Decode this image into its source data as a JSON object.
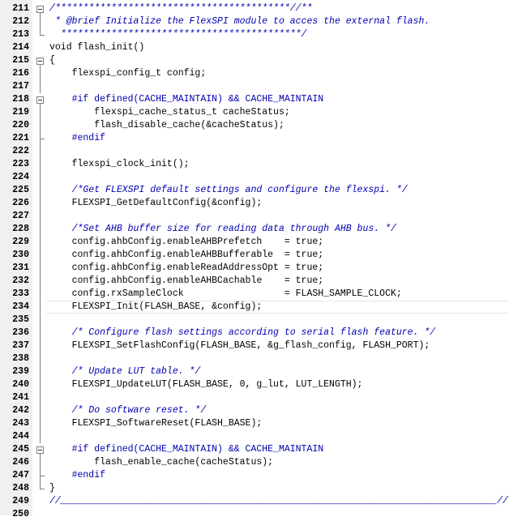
{
  "editor": {
    "lines": [
      {
        "num": "211",
        "text": "/******************************************//**"
      },
      {
        "num": "212",
        "text": " * @brief Initialize the FlexSPI module to acces the external flash."
      },
      {
        "num": "213",
        "text": "  *******************************************/"
      },
      {
        "num": "214",
        "text": "void flash_init()"
      },
      {
        "num": "215",
        "text": "{"
      },
      {
        "num": "216",
        "text": "    flexspi_config_t config;"
      },
      {
        "num": "217",
        "text": ""
      },
      {
        "num": "218",
        "text": "    #if defined(CACHE_MAINTAIN) && CACHE_MAINTAIN"
      },
      {
        "num": "219",
        "text": "        flexspi_cache_status_t cacheStatus;"
      },
      {
        "num": "220",
        "text": "        flash_disable_cache(&cacheStatus);"
      },
      {
        "num": "221",
        "text": "    #endif"
      },
      {
        "num": "222",
        "text": ""
      },
      {
        "num": "223",
        "text": "    flexspi_clock_init();"
      },
      {
        "num": "224",
        "text": ""
      },
      {
        "num": "225",
        "text": "    /*Get FLEXSPI default settings and configure the flexspi. */"
      },
      {
        "num": "226",
        "text": "    FLEXSPI_GetDefaultConfig(&config);"
      },
      {
        "num": "227",
        "text": ""
      },
      {
        "num": "228",
        "text": "    /*Set AHB buffer size for reading data through AHB bus. */"
      },
      {
        "num": "229",
        "text": "    config.ahbConfig.enableAHBPrefetch    = true;"
      },
      {
        "num": "230",
        "text": "    config.ahbConfig.enableAHBBufferable  = true;"
      },
      {
        "num": "231",
        "text": "    config.ahbConfig.enableReadAddressOpt = true;"
      },
      {
        "num": "232",
        "text": "    config.ahbConfig.enableAHBCachable    = true;"
      },
      {
        "num": "233",
        "text": "    config.rxSampleClock                  = FLASH_SAMPLE_CLOCK;"
      },
      {
        "num": "234",
        "text": "    FLEXSPI_Init(FLASH_BASE, &config);"
      },
      {
        "num": "235",
        "text": ""
      },
      {
        "num": "236",
        "text": "    /* Configure flash settings according to serial flash feature. */"
      },
      {
        "num": "237",
        "text": "    FLEXSPI_SetFlashConfig(FLASH_BASE, &g_flash_config, FLASH_PORT);"
      },
      {
        "num": "238",
        "text": ""
      },
      {
        "num": "239",
        "text": "    /* Update LUT table. */"
      },
      {
        "num": "240",
        "text": "    FLEXSPI_UpdateLUT(FLASH_BASE, 0, g_lut, LUT_LENGTH);"
      },
      {
        "num": "241",
        "text": ""
      },
      {
        "num": "242",
        "text": "    /* Do software reset. */"
      },
      {
        "num": "243",
        "text": "    FLEXSPI_SoftwareReset(FLASH_BASE);"
      },
      {
        "num": "244",
        "text": ""
      },
      {
        "num": "245",
        "text": "    #if defined(CACHE_MAINTAIN) && CACHE_MAINTAIN"
      },
      {
        "num": "246",
        "text": "        flash_enable_cache(cacheStatus);"
      },
      {
        "num": "247",
        "text": "    #endif"
      },
      {
        "num": "248",
        "text": "}"
      },
      {
        "num": "249",
        "text": "//______________________________________________________________________________//"
      },
      {
        "num": "250",
        "text": ""
      }
    ],
    "colors": {
      "comment": "#0000b0",
      "preprocessor": "#0000b0",
      "text": "#000000",
      "gutter_bg": "#f0f0f0"
    }
  }
}
